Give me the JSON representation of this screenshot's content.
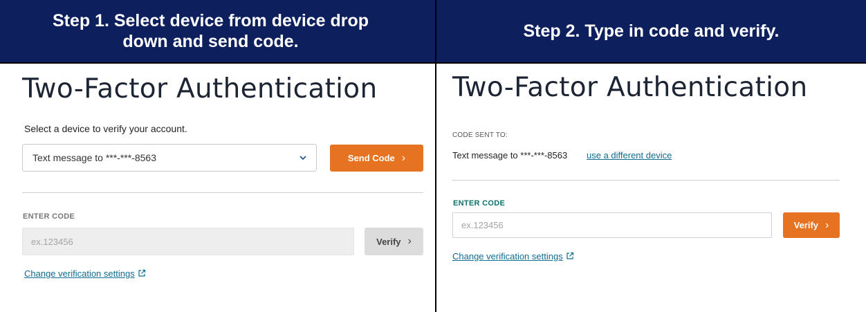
{
  "steps": [
    {
      "header": "Step 1. Select device from device drop down and send code.",
      "title": "Two-Factor Authentication",
      "instruction": "Select a device to verify your account.",
      "device_select": {
        "value": "Text message to ***-***-8563"
      },
      "send_code_label": "Send Code",
      "enter_code_label": "ENTER CODE",
      "code_input": {
        "placeholder": "ex.123456"
      },
      "verify_label": "Verify",
      "change_settings_link": "Change verification settings"
    },
    {
      "header": "Step 2. Type in code and verify.",
      "title": "Two-Factor Authentication",
      "code_sent_label": "CODE SENT TO:",
      "sent_to_text": "Text message to ***-***-8563",
      "different_device_link": "use a different device",
      "enter_code_label": "ENTER CODE",
      "code_input": {
        "placeholder": "ex.123456"
      },
      "verify_label": "Verify",
      "change_settings_link": "Change verification settings"
    }
  ],
  "colors": {
    "header_bg": "#0d1f5c",
    "accent_orange": "#e67322",
    "link": "#0f6c8f",
    "label_teal": "#0e6f6b",
    "disabled_grey": "#dcdcdc"
  },
  "icons": [
    "chevron-down-icon",
    "chevron-right-icon",
    "external-link-icon"
  ]
}
